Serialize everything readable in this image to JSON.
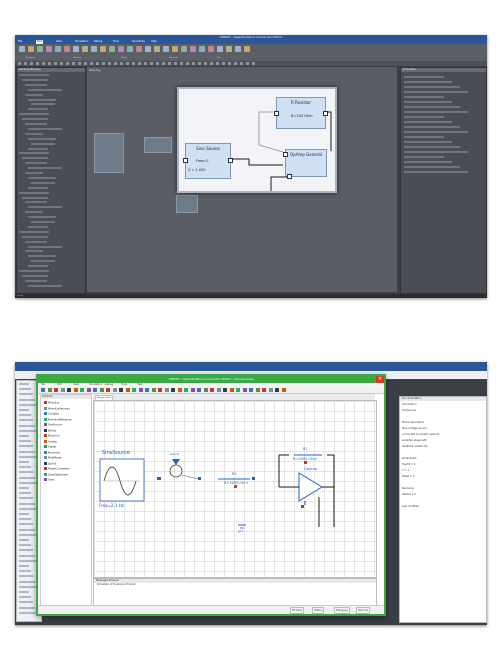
{
  "top": {
    "window_title": "OMEdit - OpenModelica Connection Editor",
    "menus": [
      "File",
      "Edit",
      "View",
      "Simulation",
      "Debug",
      "Tools",
      "Sensitivity",
      "Help"
    ],
    "ribbon_groups": [
      "Clipboard",
      "Libraries",
      "Model",
      "Simulate",
      "Plot"
    ],
    "left_panel_title": "Libraries Browser",
    "canvas_tab": "Modeling",
    "right_panel_title": "Properties",
    "status": "Ready",
    "zoom": {
      "resistor_name": "R Resistor",
      "resistor_param": "R=100 Ohm",
      "source_name": "Sine Source",
      "source_param1": "Freq=2",
      "source_param2": "V = 1.000",
      "amp_name": "OpAmp General"
    }
  },
  "bottom": {
    "window_title": "OMEdit - OpenModelica Connection Editor - [SineSource]",
    "menus": [
      "File",
      "Edit",
      "View",
      "Simulation",
      "Debug",
      "Tools",
      "Help"
    ],
    "library_header": "Libraries",
    "library_items": [
      {
        "label": "Modelica",
        "color": "#c0392b"
      },
      {
        "label": "ModelicaServices",
        "color": "#7f8c8d"
      },
      {
        "label": "Complex",
        "color": "#2980b9"
      },
      {
        "label": "ModelicaReference",
        "color": "#27ae60"
      },
      {
        "label": "SineSource",
        "color": "#8e44ad"
      },
      {
        "label": "Blocks",
        "color": "#2c3e50"
      },
      {
        "label": "Electrical",
        "color": "#c0392b"
      },
      {
        "label": "Analog",
        "color": "#d35400"
      },
      {
        "label": "Digital",
        "color": "#16a085"
      },
      {
        "label": "Machines",
        "color": "#2980b9"
      },
      {
        "label": "MultiPhase",
        "color": "#7f8c8d"
      },
      {
        "label": "Spice3",
        "color": "#2c3e50"
      },
      {
        "label": "PowerConverters",
        "color": "#c0392b"
      },
      {
        "label": "QuasiStationary",
        "color": "#27ae60"
      },
      {
        "label": "Icons",
        "color": "#8e44ad"
      }
    ],
    "diagram_tab": "Diagram View",
    "labels": {
      "sinesource": "SineSource",
      "freq": "Freq=2-1 Hz",
      "resistor_top": "R1",
      "resistor_top_val": "R=2000 Ohm",
      "resistor_mid": "R2",
      "resistor_mid_val": "R=1000 Ohm",
      "ground": "Ground",
      "opamp": "OpAmp",
      "ground2": "gnd"
    },
    "messages_header": "Messages Browser",
    "message_line": "Simulation of SineSource finished",
    "status_buttons": [
      "Modeling",
      "Plotting",
      "Debugging",
      "Welcome"
    ],
    "right_panel_title": "Documentation",
    "right_lines": [
      "Information",
      "SineSource",
      "",
      "Model description",
      "Sine voltage source",
      "connected to resistor network",
      "amplifier stage with",
      "feedback resistor R1",
      "",
      "Parameters:",
      "freqHz = 2",
      "V = 1",
      "offset = 0",
      "",
      "Revisions",
      "Version 1.0",
      "",
      "Last modified"
    ]
  },
  "colors": {
    "accent": "#2b579a",
    "window_border": "#3ca845",
    "close": "#d53a2e",
    "wire": "#1a1a1a",
    "label_blue": "#2060c0"
  }
}
